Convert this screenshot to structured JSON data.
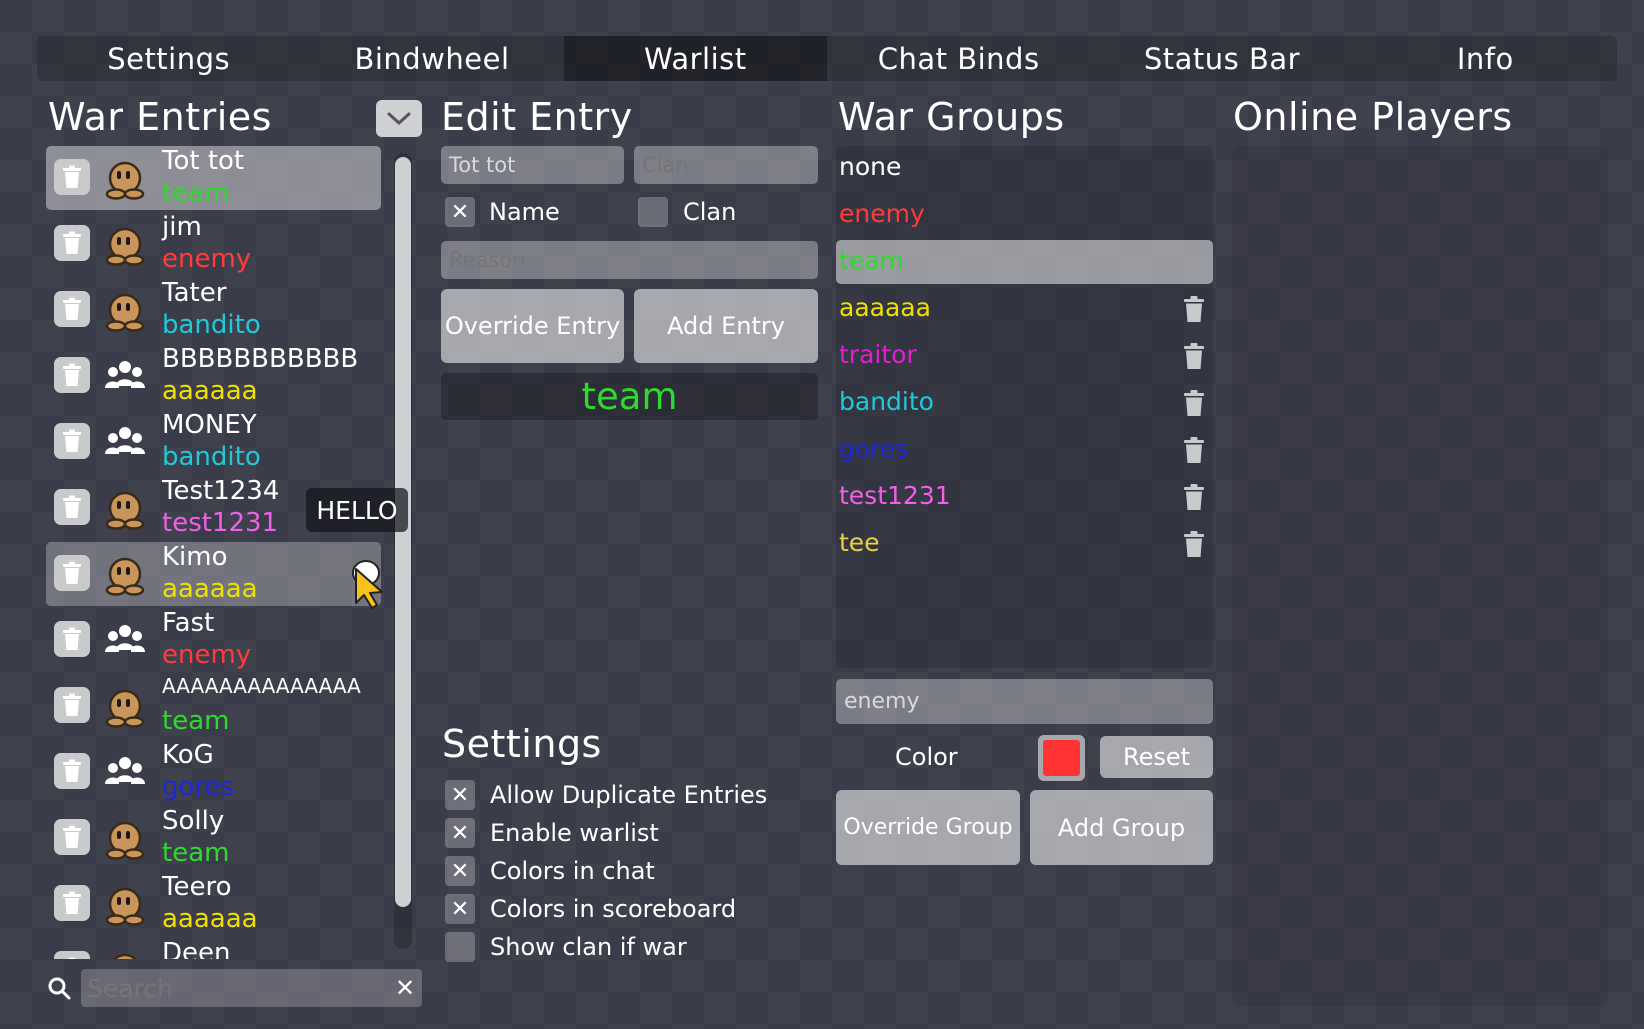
{
  "tabs": [
    "Settings",
    "Bindwheel",
    "Warlist",
    "Chat Binds",
    "Status Bar",
    "Info"
  ],
  "active_tab": "Warlist",
  "war_entries": {
    "title": "War Entries",
    "tooltip": "HELLO",
    "search_placeholder": "Search",
    "items": [
      {
        "name": "Tot tot",
        "group": "team",
        "color": "#2fd92f",
        "icon": "tee-avatar-icon",
        "state": "selected"
      },
      {
        "name": "jim",
        "group": "enemy",
        "color": "#ff3b3b",
        "icon": "tee-avatar-icon"
      },
      {
        "name": "Tater",
        "group": "bandito",
        "color": "#20c8d8",
        "icon": "tee-avatar-icon"
      },
      {
        "name": "BBBBBBBBBBB",
        "group": "aaaaaa",
        "color": "#f0e000",
        "icon": "people-group-icon"
      },
      {
        "name": "MONEY",
        "group": "bandito",
        "color": "#20c8d8",
        "icon": "people-group-icon"
      },
      {
        "name": "Test1234",
        "group": "test1231",
        "color": "#f060e8",
        "icon": "tee-avatar-icon"
      },
      {
        "name": "Kimo",
        "group": "aaaaaa",
        "color": "#f0e000",
        "icon": "tee-avatar-icon",
        "state": "hover"
      },
      {
        "name": "Fast",
        "group": "enemy",
        "color": "#ff3b3b",
        "icon": "people-group-icon"
      },
      {
        "name": "AAAAAAAAAAAAAA",
        "group": "team",
        "color": "#2fd92f",
        "icon": "tee-avatar-icon"
      },
      {
        "name": "KoG",
        "group": "gores",
        "color": "#1e28d8",
        "icon": "people-group-icon"
      },
      {
        "name": "Solly",
        "group": "team",
        "color": "#2fd92f",
        "icon": "tee-avatar-icon"
      },
      {
        "name": "Teero",
        "group": "aaaaaa",
        "color": "#f0e000",
        "icon": "tee-avatar-icon"
      },
      {
        "name": "Deen",
        "group": "",
        "color": "#ffffff",
        "icon": "tee-avatar-icon"
      }
    ]
  },
  "edit_entry": {
    "title": "Edit Entry",
    "name_value": "Tot tot",
    "clan_placeholder": "Clan",
    "name_check_label": "Name",
    "name_checked": true,
    "clan_check_label": "Clan",
    "clan_checked": false,
    "reason_placeholder": "Reason",
    "override_label": "Override Entry",
    "add_label": "Add Entry",
    "preview_group": "team",
    "preview_color": "#2fd92f"
  },
  "settings": {
    "title": "Settings",
    "options": [
      {
        "label": "Allow Duplicate Entries",
        "checked": true
      },
      {
        "label": "Enable warlist",
        "checked": true
      },
      {
        "label": "Colors in chat",
        "checked": true
      },
      {
        "label": "Colors in scoreboard",
        "checked": true
      },
      {
        "label": "Show clan if war",
        "checked": false
      }
    ]
  },
  "war_groups": {
    "title": "War Groups",
    "groups": [
      {
        "name": "none",
        "color": "#ffffff",
        "deletable": false
      },
      {
        "name": "enemy",
        "color": "#ff3b3b",
        "deletable": false
      },
      {
        "name": "team",
        "color": "#2fd92f",
        "deletable": false,
        "selected": true
      },
      {
        "name": "aaaaaa",
        "color": "#f0e000",
        "deletable": true
      },
      {
        "name": "traitor",
        "color": "#e020d0",
        "deletable": true
      },
      {
        "name": "bandito",
        "color": "#20c8d8",
        "deletable": true
      },
      {
        "name": "gores",
        "color": "#1e28d8",
        "deletable": true
      },
      {
        "name": "test1231",
        "color": "#f060e8",
        "deletable": true
      },
      {
        "name": "tee",
        "color": "#e8d040",
        "deletable": true
      }
    ],
    "group_name_value": "enemy",
    "color_label": "Color",
    "color_value": "#ff3333",
    "reset_label": "Reset",
    "override_label": "Override Group",
    "add_label": "Add Group"
  },
  "online_players": {
    "title": "Online Players"
  }
}
